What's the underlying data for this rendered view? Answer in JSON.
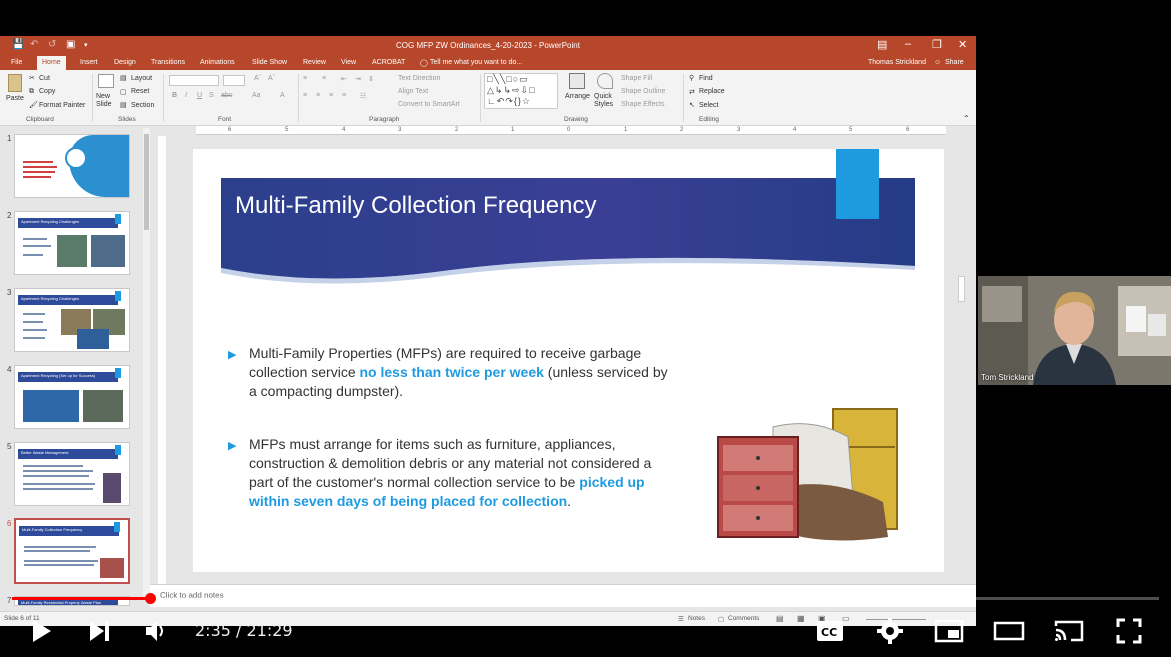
{
  "window": {
    "title": "COG MFP ZW Ordinances_4-20-2023 - PowerPoint",
    "user": "Thomas Strickland",
    "share": "Share"
  },
  "menu": {
    "tabs": [
      "File",
      "Home",
      "Insert",
      "Design",
      "Transitions",
      "Animations",
      "Slide Show",
      "Review",
      "View",
      "ACROBAT"
    ],
    "active": "Home",
    "tell_me": "Tell me what you want to do..."
  },
  "ribbon": {
    "clipboard": {
      "paste": "Paste",
      "cut": "Cut",
      "copy": "Copy",
      "format_painter": "Format Painter",
      "label": "Clipboard"
    },
    "slides": {
      "new_slide": "New Slide",
      "layout": "Layout",
      "reset": "Reset",
      "section": "Section",
      "label": "Slides"
    },
    "font": {
      "label": "Font"
    },
    "paragraph": {
      "text_direction": "Text Direction",
      "align_text": "Align Text",
      "smartart": "Convert to SmartArt",
      "label": "Paragraph"
    },
    "drawing": {
      "arrange": "Arrange",
      "quick_styles": "Quick Styles",
      "shape_fill": "Shape Fill",
      "shape_outline": "Shape Outline",
      "shape_effects": "Shape Effects",
      "label": "Drawing"
    },
    "editing": {
      "find": "Find",
      "replace": "Replace",
      "select": "Select",
      "label": "Editing"
    }
  },
  "ruler_ticks": [
    "6",
    "5",
    "4",
    "3",
    "2",
    "1",
    "0",
    "1",
    "2",
    "3",
    "4",
    "5",
    "6"
  ],
  "thumbnails": [
    {
      "num": "1",
      "title": ""
    },
    {
      "num": "2",
      "title": "Apartment Recycling Challenges"
    },
    {
      "num": "3",
      "title": "Apartment Recycling Challenges"
    },
    {
      "num": "4",
      "title": "Apartment Recycling (Set up for Success)"
    },
    {
      "num": "5",
      "title": "Better Waste Management"
    },
    {
      "num": "6",
      "title": "Multi-Family Collection Frequency"
    },
    {
      "num": "7",
      "title": "Multi-Family Residential Property Waste Plan"
    }
  ],
  "slide": {
    "title": "Multi-Family Collection Frequency",
    "b1_a": "Multi-Family Properties (MFPs) are required to receive garbage collection service ",
    "b1_hl": "no less than twice per week",
    "b1_b": " (unless serviced by a compacting dumpster).",
    "b2_a": "MFPs must arrange for items such as furniture, appliances, construction & demolition debris or any material not considered a part of the customer's normal collection service to be ",
    "b2_hl": "picked up within seven days of being placed for collection",
    "b2_b": "."
  },
  "notes": {
    "placeholder": "Click to add notes"
  },
  "status": {
    "slide": "Slide 6 of 11",
    "notes": "Notes",
    "comments": "Comments"
  },
  "webcam": {
    "name": "Tom Strickland"
  },
  "player": {
    "current": "2:35",
    "duration": "21:29",
    "time_display": "2:35 / 21:29",
    "progress": 0.12,
    "accent": "#ff0000"
  },
  "colors": {
    "ppt_accent": "#b7472a",
    "slide_blue": "#1e9be0",
    "banner": "#2e3f8f"
  }
}
